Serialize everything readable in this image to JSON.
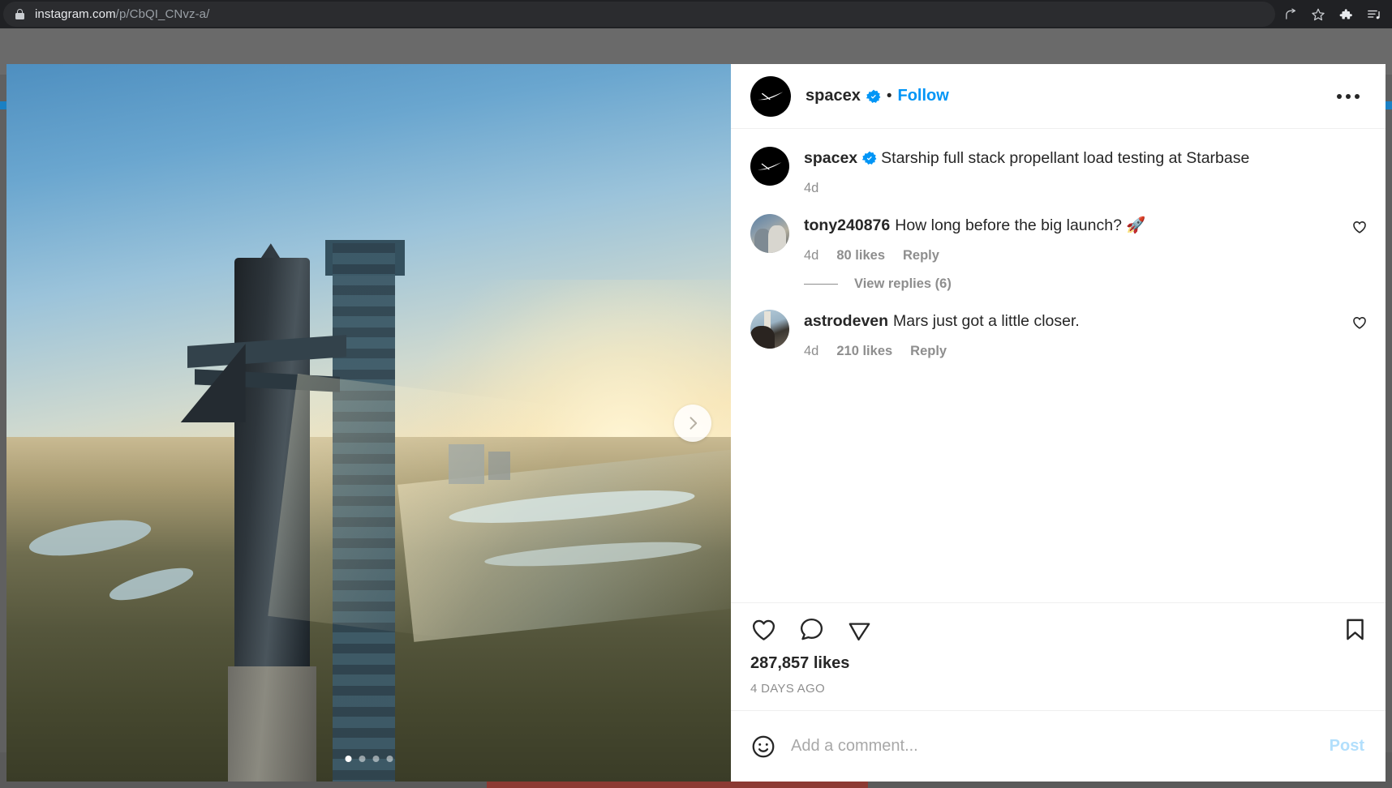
{
  "browser": {
    "url_host": "instagram.com",
    "url_path": "/p/CbQI_CNvz-a/",
    "icons": [
      "lock-icon",
      "share-icon",
      "bookmark-star-icon",
      "extensions-puzzle-icon",
      "reading-list-icon"
    ]
  },
  "post": {
    "header": {
      "username": "spacex",
      "separator": "•",
      "follow_label": "Follow",
      "verified": true,
      "more_options_label": "···"
    },
    "caption": {
      "username": "spacex",
      "verified": true,
      "text": "Starship full stack propellant load testing at Starbase",
      "time": "4d"
    },
    "comments": [
      {
        "username": "tony240876",
        "text": "How long before the big launch? 🚀",
        "time": "4d",
        "likes": "80 likes",
        "reply_label": "Reply",
        "replies_label": "View replies (6)",
        "replies_count": 6
      },
      {
        "username": "astrodeven",
        "text": "Mars just got a little closer.",
        "time": "4d",
        "likes": "210 likes",
        "reply_label": "Reply",
        "replies_label": "",
        "replies_count": 0
      }
    ],
    "actions": {
      "like_icon": "heart-icon",
      "comment_icon": "comment-bubble-icon",
      "share_icon": "share-paper-plane-icon",
      "save_icon": "bookmark-icon"
    },
    "likes_count": "287,857 likes",
    "posted_date": "4 DAYS AGO",
    "add_comment": {
      "placeholder": "Add a comment...",
      "value": "",
      "post_label": "Post",
      "emoji_icon": "emoji-smiley-icon"
    },
    "carousel": {
      "slides": 4,
      "active_index": 0,
      "next_label": "›"
    }
  },
  "colors": {
    "accent_blue": "#0095f6",
    "post_disabled_blue": "#b2dffc",
    "text_primary": "#262626",
    "text_muted": "#8e8e8e",
    "backdrop": "#606060"
  }
}
